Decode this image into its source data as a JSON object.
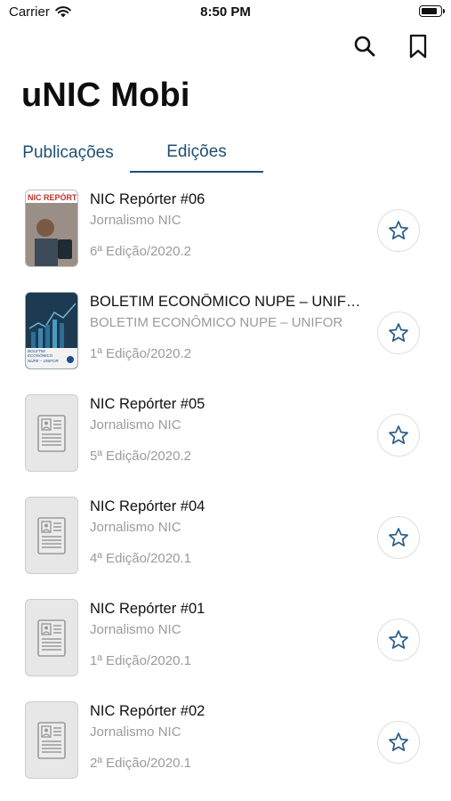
{
  "status_bar": {
    "carrier": "Carrier",
    "time": "8:50 PM"
  },
  "header": {
    "title": "uNIC Mobi"
  },
  "tabs": [
    {
      "label": "Publicações",
      "active": false
    },
    {
      "label": "Edições",
      "active": true
    }
  ],
  "items": [
    {
      "title": "NIC Repórter #06",
      "subtitle": "Jornalismo NIC",
      "edition": "6ª Edição/2020.2",
      "thumbnail": "cover-nic-reporter",
      "cover_text": "NIC REPÓRTER"
    },
    {
      "title": "BOLETIM  ECONÔMICO  NUPE – UNIF…",
      "subtitle": "BOLETIM  ECONÔMICO  NUPE – UNIFOR",
      "edition": "1ª Edição/2020.2",
      "thumbnail": "cover-boletim",
      "cover_text": "BOLETIM ECONÔMICO NUPE – UNIFOR"
    },
    {
      "title": "NIC Repórter #05",
      "subtitle": "Jornalismo NIC",
      "edition": "5ª Edição/2020.2",
      "thumbnail": "document-placeholder-icon"
    },
    {
      "title": "NIC Repórter #04",
      "subtitle": "Jornalismo NIC",
      "edition": "4ª Edição/2020.1",
      "thumbnail": "document-placeholder-icon"
    },
    {
      "title": "NIC Repórter #01",
      "subtitle": "Jornalismo NIC",
      "edition": "1ª Edição/2020.1",
      "thumbnail": "document-placeholder-icon"
    },
    {
      "title": "NIC Repórter #02",
      "subtitle": "Jornalismo NIC",
      "edition": "2ª Edição/2020.1",
      "thumbnail": "document-placeholder-icon"
    }
  ],
  "icons": {
    "search": "search-icon",
    "bookmark": "bookmark-icon",
    "favorite": "star-outline-icon"
  },
  "colors": {
    "accent": "#1f4e73",
    "secondary_text": "#9b9b9b",
    "star": "#2d5f8a"
  }
}
